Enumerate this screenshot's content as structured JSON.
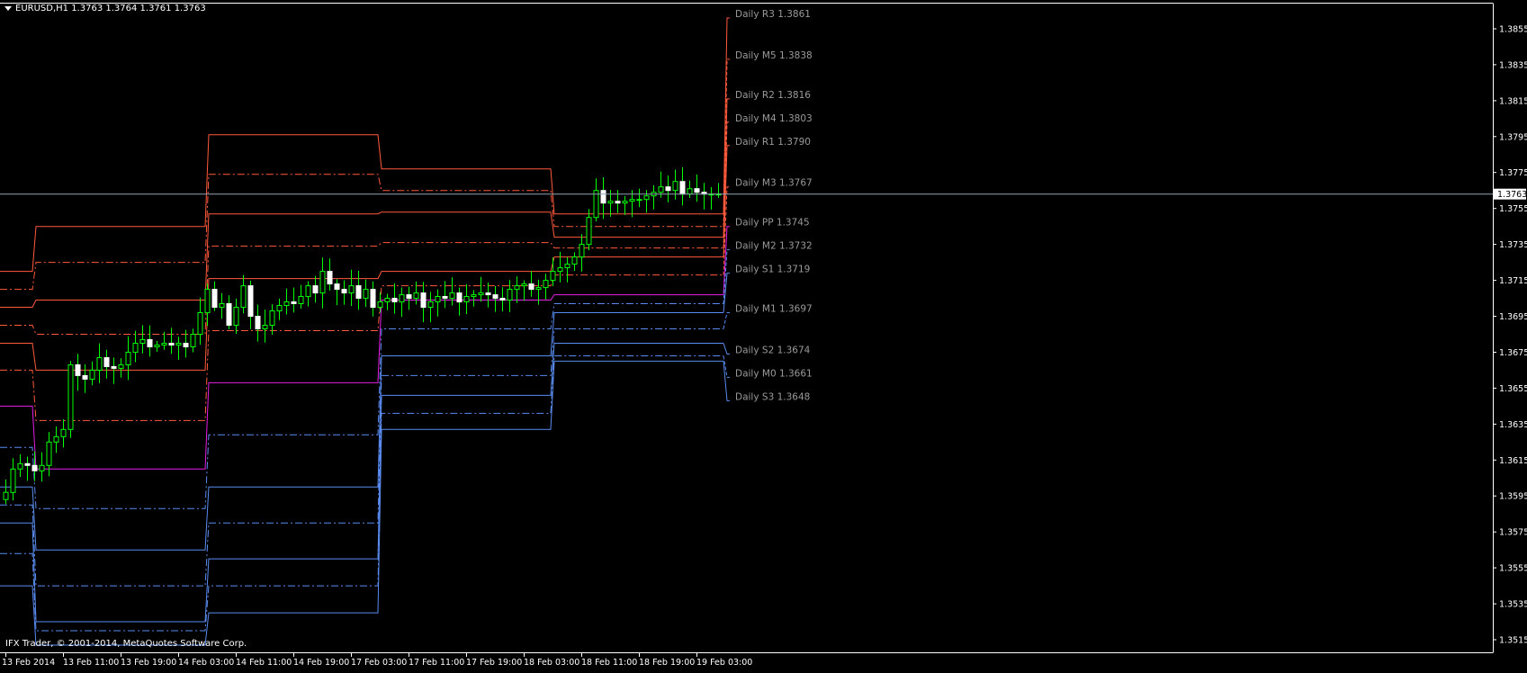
{
  "header": {
    "symbol_line": "EURUSD,H1  1.3763 1.3764 1.3761 1.3763"
  },
  "copyright": "IFX Trader, © 2001-2014, MetaQuotes Software Corp.",
  "colors": {
    "background": "#000000",
    "axis": "#ffffff",
    "bull_candle": "#00ff00",
    "bear_candle": "#ffffff",
    "resistance": "#ff5a3c",
    "pivot": "#e61ee6",
    "support": "#5a8cf0",
    "price_line": "#8fa3b5",
    "label_text": "#9a9a9a"
  },
  "chart_data": {
    "type": "candlestick",
    "symbol": "EURUSD",
    "timeframe": "H1",
    "current_price": 1.3763,
    "ylim": [
      1.3508,
      1.3869
    ],
    "y_ticks": [
      1.3515,
      1.3535,
      1.3555,
      1.3575,
      1.3595,
      1.3615,
      1.3635,
      1.3655,
      1.3675,
      1.3695,
      1.3715,
      1.3735,
      1.3755,
      1.3775,
      1.3795,
      1.3815,
      1.3835,
      1.3855
    ],
    "x_labels": [
      "13 Feb 2014",
      "13 Feb 11:00",
      "13 Feb 19:00",
      "14 Feb 03:00",
      "14 Feb 11:00",
      "14 Feb 19:00",
      "17 Feb 03:00",
      "17 Feb 11:00",
      "17 Feb 19:00",
      "18 Feb 03:00",
      "18 Feb 11:00",
      "18 Feb 19:00",
      "19 Feb 03:00"
    ],
    "x_label_bars": [
      0,
      8,
      16,
      24,
      32,
      40,
      48,
      56,
      64,
      72,
      80,
      88,
      96
    ],
    "bar_count": 100,
    "days": [
      {
        "start_bar": 0,
        "end_bar": 4,
        "levels": {
          "R3": 1.372,
          "M5": 1.371,
          "R2": 1.37,
          "M4": 1.369,
          "R1": 1.368,
          "M3": 1.3665,
          "PP": 1.3645,
          "M2": 1.3622,
          "S1": 1.36,
          "M1": 1.359,
          "S2": 1.358,
          "M0": 1.3563,
          "S3": 1.3545
        }
      },
      {
        "start_bar": 4,
        "end_bar": 28,
        "levels": {
          "R3": 1.3745,
          "M5": 1.3725,
          "R2": 1.3704,
          "M4": 1.3685,
          "R1": 1.3665,
          "M3": 1.3637,
          "PP": 1.361,
          "M2": 1.3588,
          "S1": 1.3565,
          "M1": 1.3545,
          "S2": 1.3525,
          "M0": 1.352,
          "S3": 1.3512
        }
      },
      {
        "start_bar": 28,
        "end_bar": 52,
        "levels": {
          "R3": 1.3796,
          "M5": 1.3774,
          "R2": 1.3752,
          "M4": 1.3734,
          "R1": 1.3716,
          "M3": 1.3687,
          "PP": 1.3658,
          "M2": 1.3629,
          "S1": 1.36,
          "M1": 1.358,
          "S2": 1.356,
          "M0": 1.3545,
          "S3": 1.353
        }
      },
      {
        "start_bar": 52,
        "end_bar": 76,
        "levels": {
          "R3": 1.3777,
          "M5": 1.3765,
          "R2": 1.3753,
          "M4": 1.3736,
          "R1": 1.372,
          "M3": 1.3712,
          "PP": 1.3704,
          "M2": 1.3688,
          "S1": 1.3673,
          "M1": 1.3662,
          "S2": 1.3651,
          "M0": 1.3641,
          "S3": 1.3632
        }
      },
      {
        "start_bar": 76,
        "end_bar": 100,
        "levels": {
          "R3": 1.3752,
          "M5": 1.3745,
          "R2": 1.3739,
          "M4": 1.3733,
          "R1": 1.3728,
          "M3": 1.3718,
          "PP": 1.3707,
          "M2": 1.3702,
          "S1": 1.3697,
          "M1": 1.3688,
          "S2": 1.368,
          "M0": 1.3673,
          "S3": 1.367
        }
      }
    ],
    "forecast_levels": [
      {
        "key": "R3",
        "label": "Daily R3 1.3861",
        "value": 1.3861,
        "group": "resistance",
        "style": "solid"
      },
      {
        "key": "M5",
        "label": "Daily M5 1.3838",
        "value": 1.3838,
        "group": "resistance",
        "style": "dash"
      },
      {
        "key": "R2",
        "label": "Daily R2 1.3816",
        "value": 1.3816,
        "group": "resistance",
        "style": "solid"
      },
      {
        "key": "M4",
        "label": "Daily M4 1.3803",
        "value": 1.3803,
        "group": "resistance",
        "style": "dash"
      },
      {
        "key": "R1",
        "label": "Daily R1 1.3790",
        "value": 1.379,
        "group": "resistance",
        "style": "solid"
      },
      {
        "key": "M3",
        "label": "Daily M3 1.3767",
        "value": 1.3767,
        "group": "resistance",
        "style": "dash"
      },
      {
        "key": "PP",
        "label": "Daily PP 1.3745",
        "value": 1.3745,
        "group": "pivot",
        "style": "solid"
      },
      {
        "key": "M2",
        "label": "Daily M2 1.3732",
        "value": 1.3732,
        "group": "support",
        "style": "dash"
      },
      {
        "key": "S1",
        "label": "Daily S1 1.3719",
        "value": 1.3719,
        "group": "support",
        "style": "solid"
      },
      {
        "key": "M1",
        "label": "Daily M1 1.3697",
        "value": 1.3697,
        "group": "support",
        "style": "dash"
      },
      {
        "key": "S2",
        "label": "Daily S2 1.3674",
        "value": 1.3674,
        "group": "support",
        "style": "solid"
      },
      {
        "key": "M0",
        "label": "Daily M0 1.3661",
        "value": 1.3661,
        "group": "support",
        "style": "dash"
      },
      {
        "key": "S3",
        "label": "Daily S3 1.3648",
        "value": 1.3648,
        "group": "support",
        "style": "solid"
      }
    ],
    "candles_close": [
      1.3597,
      1.361,
      1.3613,
      1.3612,
      1.3609,
      1.3612,
      1.3625,
      1.3628,
      1.3632,
      1.3668,
      1.3662,
      1.366,
      1.3665,
      1.3672,
      1.3667,
      1.3666,
      1.3668,
      1.3675,
      1.368,
      1.3682,
      1.3678,
      1.3679,
      1.368,
      1.3679,
      1.368,
      1.3678,
      1.3685,
      1.3697,
      1.371,
      1.37,
      1.3702,
      1.369,
      1.37,
      1.3712,
      1.3695,
      1.3688,
      1.369,
      1.3698,
      1.3701,
      1.3703,
      1.3702,
      1.3706,
      1.3712,
      1.3708,
      1.372,
      1.3713,
      1.371,
      1.3708,
      1.3712,
      1.3705,
      1.371,
      1.37,
      1.3703,
      1.3705,
      1.3703,
      1.3707,
      1.3705,
      1.3708,
      1.37,
      1.3703,
      1.3706,
      1.3705,
      1.3708,
      1.3703,
      1.3706,
      1.3707,
      1.3708,
      1.3707,
      1.3705,
      1.3704,
      1.371,
      1.3712,
      1.3713,
      1.371,
      1.3711,
      1.3715,
      1.372,
      1.3722,
      1.3724,
      1.3728,
      1.3735,
      1.375,
      1.3765,
      1.3758,
      1.3759,
      1.3758,
      1.3759,
      1.376,
      1.376,
      1.3762,
      1.3764,
      1.3767,
      1.3765,
      1.377,
      1.3763,
      1.3766,
      1.3764,
      1.3763,
      1.3763,
      1.3763
    ]
  }
}
